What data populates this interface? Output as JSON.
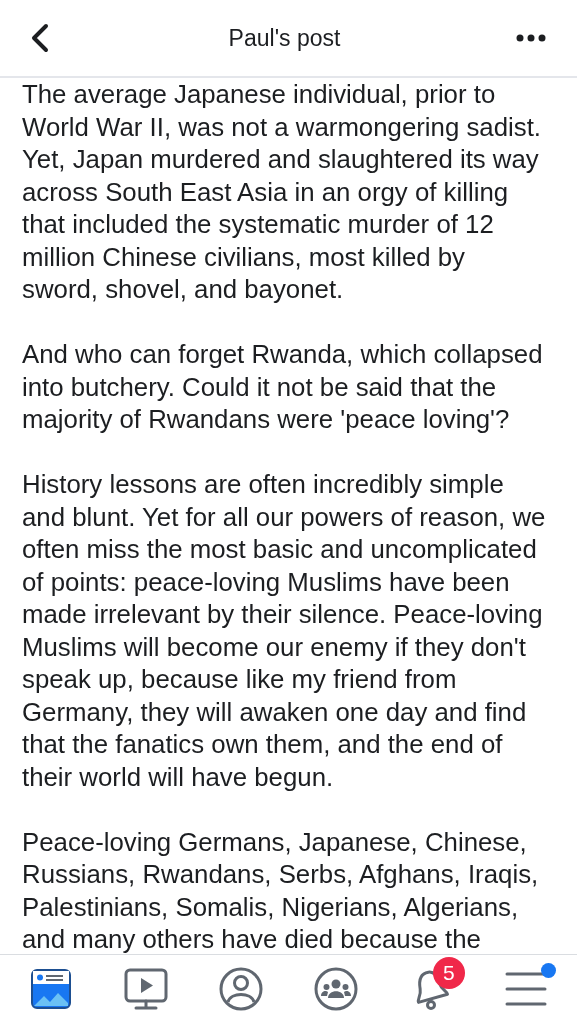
{
  "header": {
    "title": "Paul's post"
  },
  "paragraphs": [
    {
      "lines": [
        "The average Japanese individual, prior to",
        "World War II, was not a warmongering sadist.",
        "Yet, Japan murdered and slaughtered its way",
        "across South East Asia in an orgy of killing",
        "that included the systematic murder of 12",
        "million Chinese civilians, most killed by",
        "sword, shovel, and bayonet."
      ]
    },
    {
      "lines": [
        "And who can forget Rwanda, which collapsed",
        "into butchery. Could it not be said that the",
        "majority of Rwandans were 'peace loving'?"
      ]
    },
    {
      "lines": [
        "History lessons are often incredibly simple",
        "and blunt. Yet for all our powers of reason, we",
        "often miss the most basic and uncomplicated",
        "of points: peace-loving Muslims have been",
        "made irrelevant by their silence. Peace-loving",
        "Muslims will become our enemy if they don't",
        "speak up, because like my friend from",
        "Germany, they will awaken one day and find",
        "that the fanatics own them, and the end of",
        "their world will have begun."
      ]
    },
    {
      "lines": [
        "Peace-loving Germans, Japanese, Chinese,",
        "Russians, Rwandans, Serbs, Afghans, Iraqis,",
        "Palestinians, Somalis, Nigerians, Algerians,",
        "and many others have died because the"
      ]
    }
  ],
  "tab_bar": [
    {
      "kind": "feed",
      "selected": true
    },
    {
      "kind": "video",
      "selected": false
    },
    {
      "kind": "profile",
      "selected": false
    },
    {
      "kind": "groups",
      "selected": false
    },
    {
      "kind": "notifications",
      "selected": false,
      "badge": "5"
    },
    {
      "kind": "menu",
      "selected": false,
      "dot": true
    }
  ]
}
